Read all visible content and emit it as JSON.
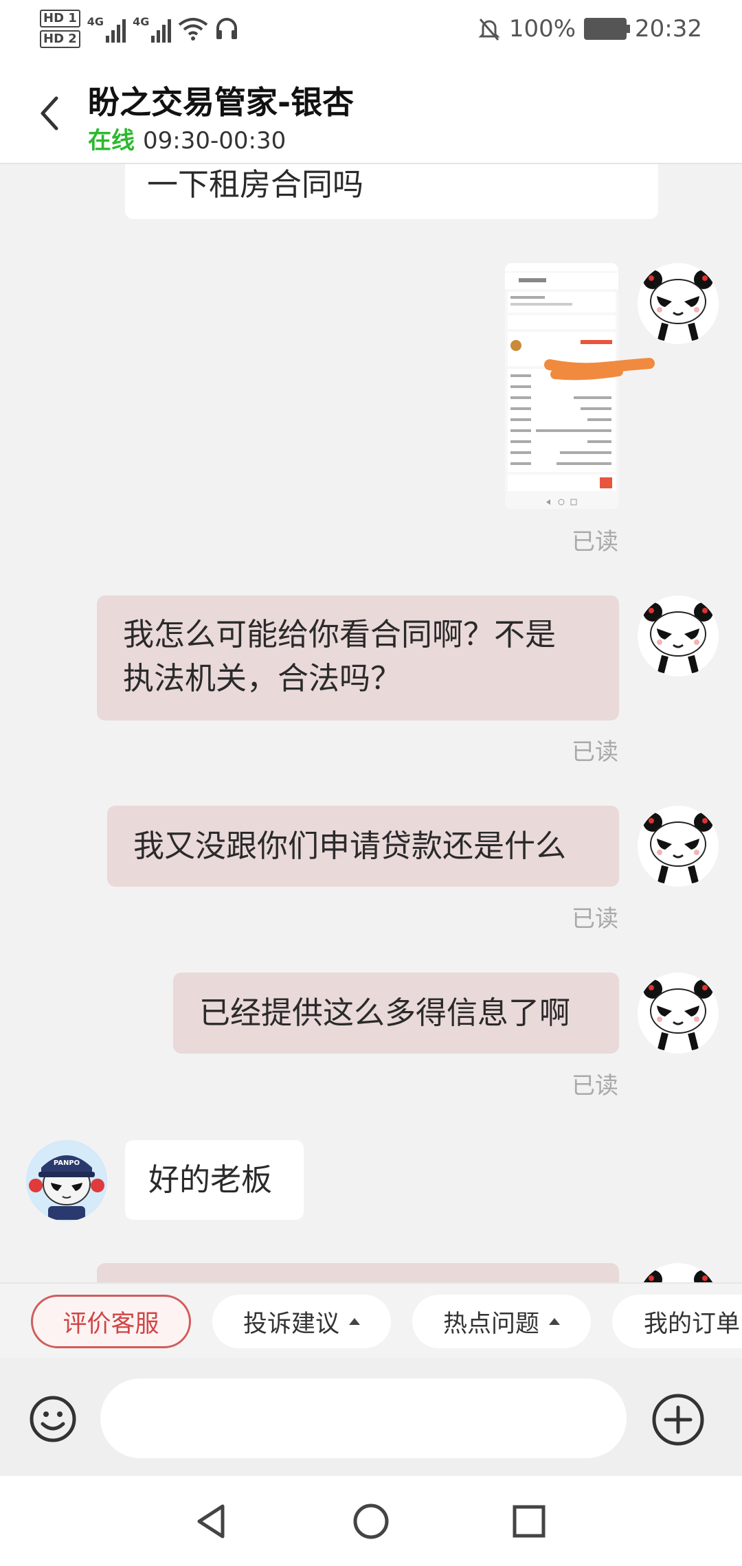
{
  "status_bar": {
    "hd1": "HD 1",
    "hd2": "HD 2",
    "sig1": "4G",
    "sig2": "4G",
    "battery": "100%",
    "time": "20:32"
  },
  "header": {
    "title": "盼之交易管家-银杏",
    "online": "在线",
    "hours": "09:30-00:30"
  },
  "messages": [
    {
      "side": "in",
      "text": "一下租房合同吗"
    },
    {
      "side": "out",
      "type": "image",
      "status": "已读"
    },
    {
      "side": "out",
      "line1": "我怎么可能给你看合同啊？不是",
      "line2": "执法机关，合法吗？",
      "status": "已读"
    },
    {
      "side": "out",
      "text": "我又没跟你们申请贷款还是什么",
      "status": "已读"
    },
    {
      "side": "out",
      "text": "已经提供这么多得信息了啊",
      "status": "已读"
    },
    {
      "side": "in",
      "text": "好的老板",
      "avatar_text": "PANPO"
    }
  ],
  "quick_actions": {
    "rate": "评价客服",
    "complaint": "投诉建议",
    "hot": "热点问题",
    "orders": "我的订单"
  },
  "input": {
    "placeholder": ""
  },
  "icons": {
    "back": "chevron-left-icon",
    "emoji": "emoji-icon",
    "plus": "plus-icon",
    "nav_back": "triangle-back-icon",
    "nav_home": "circle-home-icon",
    "nav_recents": "square-recents-icon"
  },
  "colors": {
    "online": "#2eb82e",
    "out_bubble": "#ead9d9",
    "rate_chip": "#d04545"
  }
}
